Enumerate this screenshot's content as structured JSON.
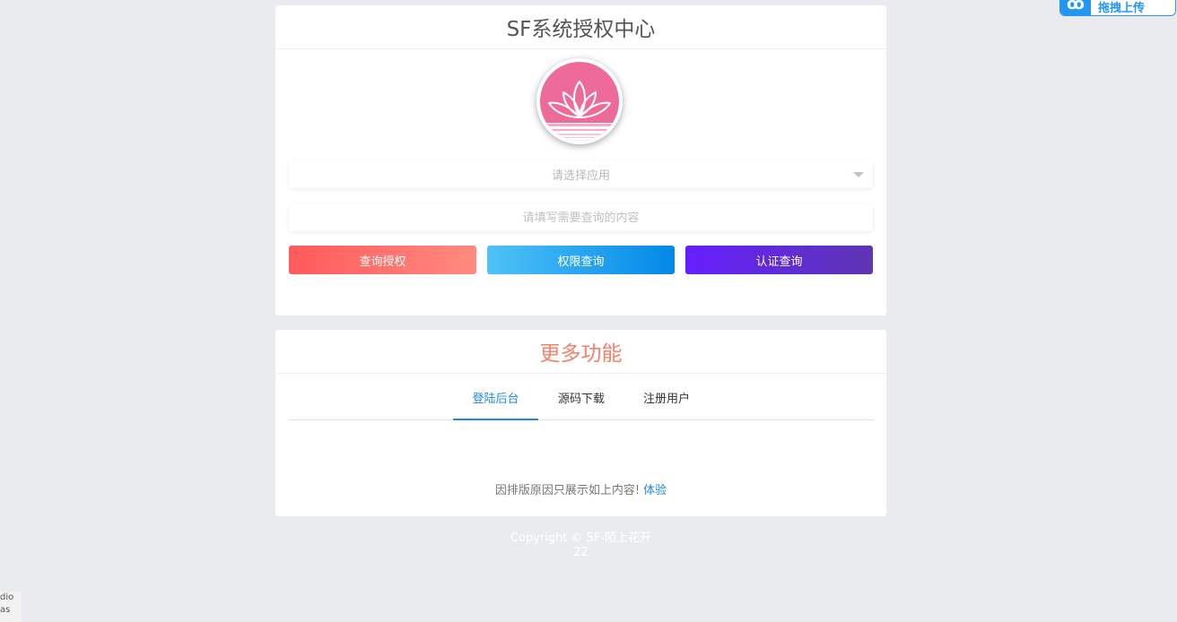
{
  "corner_badge": {
    "icon_text": "ꝏ",
    "label": "拖拽上传"
  },
  "auth_card": {
    "title": "SF系统授权中心",
    "logo_icon": "lotus-icon",
    "select_placeholder": "请选择应用",
    "input_placeholder": "请填写需要查询的内容",
    "buttons": {
      "query_auth": "查询授权",
      "perm_query": "权限查询",
      "cert_query": "认证查询"
    }
  },
  "more_card": {
    "title": "更多功能",
    "tabs": [
      "登陆后台",
      "源码下载",
      "注册用户"
    ],
    "active_tab": "登陆后台",
    "notice_text": "因排版原因只展示如上内容!",
    "notice_link": "体验"
  },
  "footer": {
    "line1": "Copyright © SF-陌上花开",
    "line2": "22"
  },
  "corner_bottom_left": {
    "line1": "dio",
    "line2": "as"
  },
  "colors": {
    "background": "#eaebef",
    "accent_blue": "#1e88e5",
    "title_orange": "#f5806c",
    "logo_pink": "#ee6a98"
  }
}
